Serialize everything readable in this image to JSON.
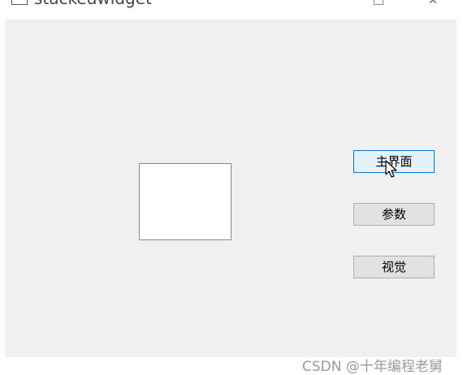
{
  "window": {
    "title": "stackedwidget"
  },
  "buttons": {
    "main": "主界面",
    "params": "参数",
    "vision": "视觉"
  },
  "watermark": "CSDN @十年编程老舅",
  "icons": {
    "app": "window-app-icon",
    "maximize": "maximize-icon",
    "close": "close-icon",
    "cursor": "mouse-pointer-icon"
  },
  "colors": {
    "client_bg": "#f0f0f0",
    "button_bg": "#e1e1e1",
    "button_hover_bg": "#e5f1fb",
    "button_hover_border": "#0078d7"
  }
}
